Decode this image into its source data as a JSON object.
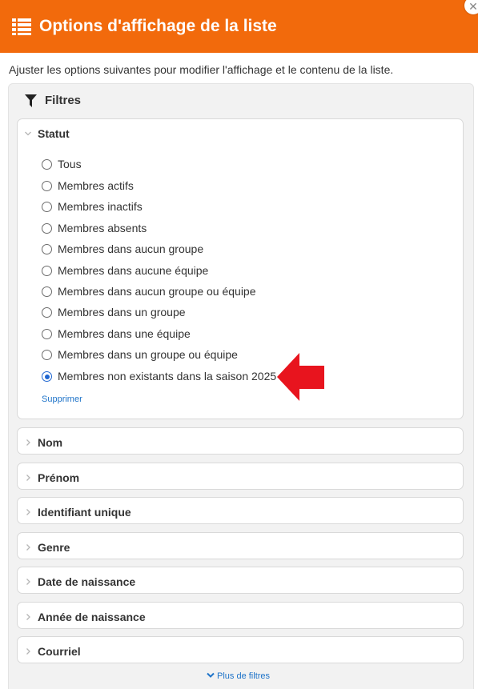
{
  "dialog": {
    "title": "Options d'affichage de la liste",
    "title_icon": "list-icon",
    "close_icon": "close-icon",
    "close_glyph": "✕",
    "description": "Ajuster les options suivantes pour modifier l'affichage et le contenu de la liste."
  },
  "filters": {
    "heading": "Filtres",
    "heading_icon": "funnel-icon",
    "statut": {
      "title": "Statut",
      "expanded": true,
      "options": [
        "Tous",
        "Membres actifs",
        "Membres inactifs",
        "Membres absents",
        "Membres dans aucun groupe",
        "Membres dans aucune équipe",
        "Membres dans aucun groupe ou équipe",
        "Membres dans un groupe",
        "Membres dans une équipe",
        "Membres dans un groupe ou équipe",
        "Membres non existants dans la saison 2025"
      ],
      "selected_index": 10,
      "remove_label": "Supprimer"
    },
    "sections": [
      {
        "title": "Nom"
      },
      {
        "title": "Prénom"
      },
      {
        "title": "Identifiant unique"
      },
      {
        "title": "Genre"
      },
      {
        "title": "Date de naissance"
      },
      {
        "title": "Année de naissance"
      },
      {
        "title": "Courriel"
      }
    ],
    "more_label": "Plus de filtres"
  },
  "colors": {
    "header_bg": "#f26a0c",
    "link": "#1f74c9",
    "radio_selected": "#1f66d1",
    "annotation_arrow": "#e8141e"
  }
}
